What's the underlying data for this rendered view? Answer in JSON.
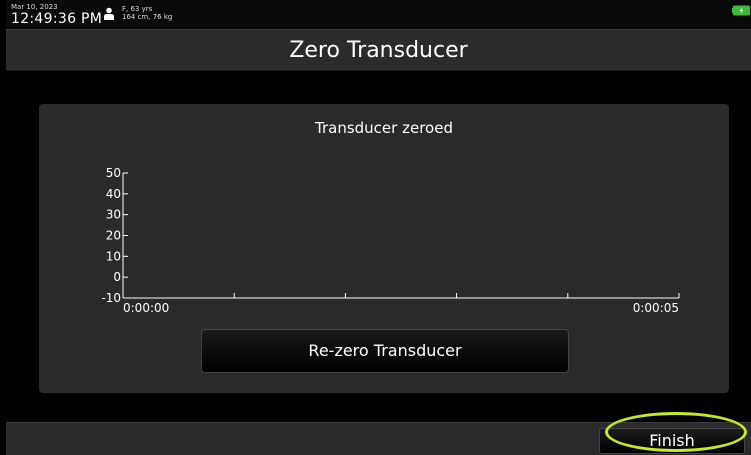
{
  "status_bar": {
    "date": "Mar 10, 2023",
    "time": "12:49:36 PM",
    "patient_icon": "person-icon",
    "patient_demographics": "F, 63 yrs",
    "patient_measurements": "164 cm, 76 kg",
    "battery_icon": "battery-charging-icon",
    "battery_color": "#3cba3c"
  },
  "title_bar": {
    "title": "Zero Transducer"
  },
  "panel": {
    "heading": "Transducer zeroed",
    "rezero_label": "Re-zero Transducer"
  },
  "chart_data": {
    "type": "line",
    "title": "",
    "xlabel": "",
    "ylabel": "",
    "y_ticks": [
      "50",
      "40",
      "30",
      "20",
      "10",
      "0",
      "-10"
    ],
    "x_tick_labels": [
      "0:00:00",
      "0:00:05"
    ],
    "ylim": [
      -10,
      50
    ],
    "xlim_seconds": [
      0,
      5
    ],
    "x_tick_count": 6,
    "series": []
  },
  "footer": {
    "finish_label": "Finish"
  },
  "colors": {
    "highlight": "#c5ea1f",
    "panel_background": "#2a2a2a",
    "bar_background": "#2b2b2b"
  }
}
